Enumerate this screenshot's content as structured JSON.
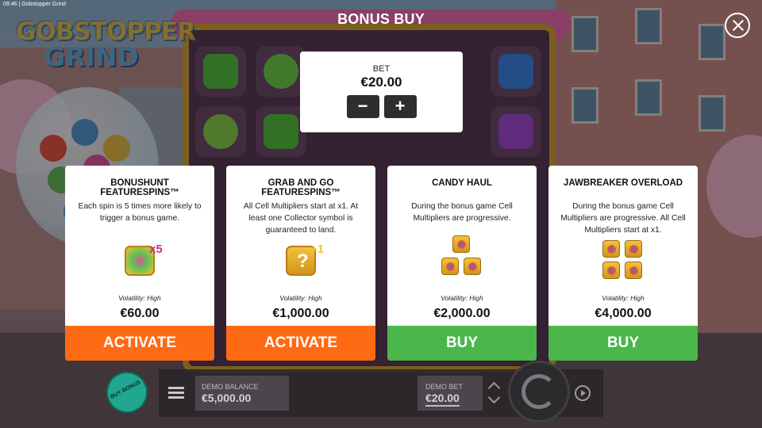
{
  "status_bar": {
    "clock": "09:46 | Gobstopper Grind"
  },
  "logo": {
    "line1": "GOBSTOPPER",
    "line2": "GRIND"
  },
  "header": {
    "title": "BONUS BUY"
  },
  "bet": {
    "label": "BET",
    "value": "€20.00",
    "minus": "−",
    "plus": "+"
  },
  "cards": [
    {
      "title": "BONUSHUNT FEATURESPINS™",
      "description": "Each spin is 5 times more likely to trigger a bonus game.",
      "icon": "scatter-x5-icon",
      "icon_badge": "x5",
      "volatility": "Volatility: High",
      "price": "€60.00",
      "action": "ACTIVATE",
      "action_color": "#ff6a14"
    },
    {
      "title": "GRAB AND GO FEATURESPINS™",
      "description": "All Cell Multipliers start at x1. At least one Collector symbol is guaranteed to land.",
      "icon": "collector-plus1-icon",
      "icon_badge": "+1",
      "volatility": "Volatility: High",
      "price": "€1,000.00",
      "action": "ACTIVATE",
      "action_color": "#ff6a14"
    },
    {
      "title": "CANDY HAUL",
      "description": "During the bonus game Cell Multipliers are progressive.",
      "icon": "three-gumball-icon",
      "volatility": "Volatility: High",
      "price": "€2,000.00",
      "action": "BUY",
      "action_color": "#4bb64a"
    },
    {
      "title": "JAWBREAKER OVERLOAD",
      "description": "During the bonus game Cell Multipliers are progressive. All Cell Multipliers start at x1.",
      "icon": "four-gumball-icon",
      "volatility": "Volatility: High",
      "price": "€4,000.00",
      "action": "BUY",
      "action_color": "#4bb64a"
    }
  ],
  "bottom_bar": {
    "buy_bonus": "BUY BONUS",
    "demo_balance_label": "DEMO BALANCE",
    "demo_balance_value": "€5,000.00",
    "demo_bet_label": "DEMO BET",
    "demo_bet_value": "€20.00"
  }
}
